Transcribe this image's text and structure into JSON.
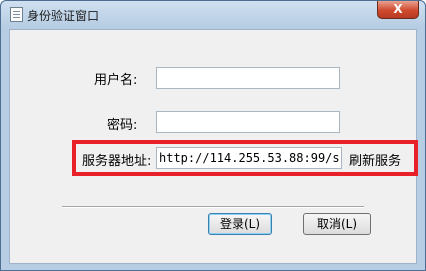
{
  "window": {
    "title": "身份验证窗口",
    "close_glyph": "X"
  },
  "form": {
    "username_label": "用户名:",
    "username_value": "",
    "password_label": "密码:",
    "password_value": "",
    "server_label": "服务器地址:",
    "server_value": "http://114.255.53.88:99/s",
    "refresh_label": "刷新服务"
  },
  "buttons": {
    "login_label": "登录(L)",
    "cancel_label": "取消(L)"
  },
  "colors": {
    "highlight_border": "#e8202a",
    "close_button": "#cf4a2e"
  },
  "icons": {
    "window_icon": "document-icon",
    "close_icon": "close-icon"
  }
}
